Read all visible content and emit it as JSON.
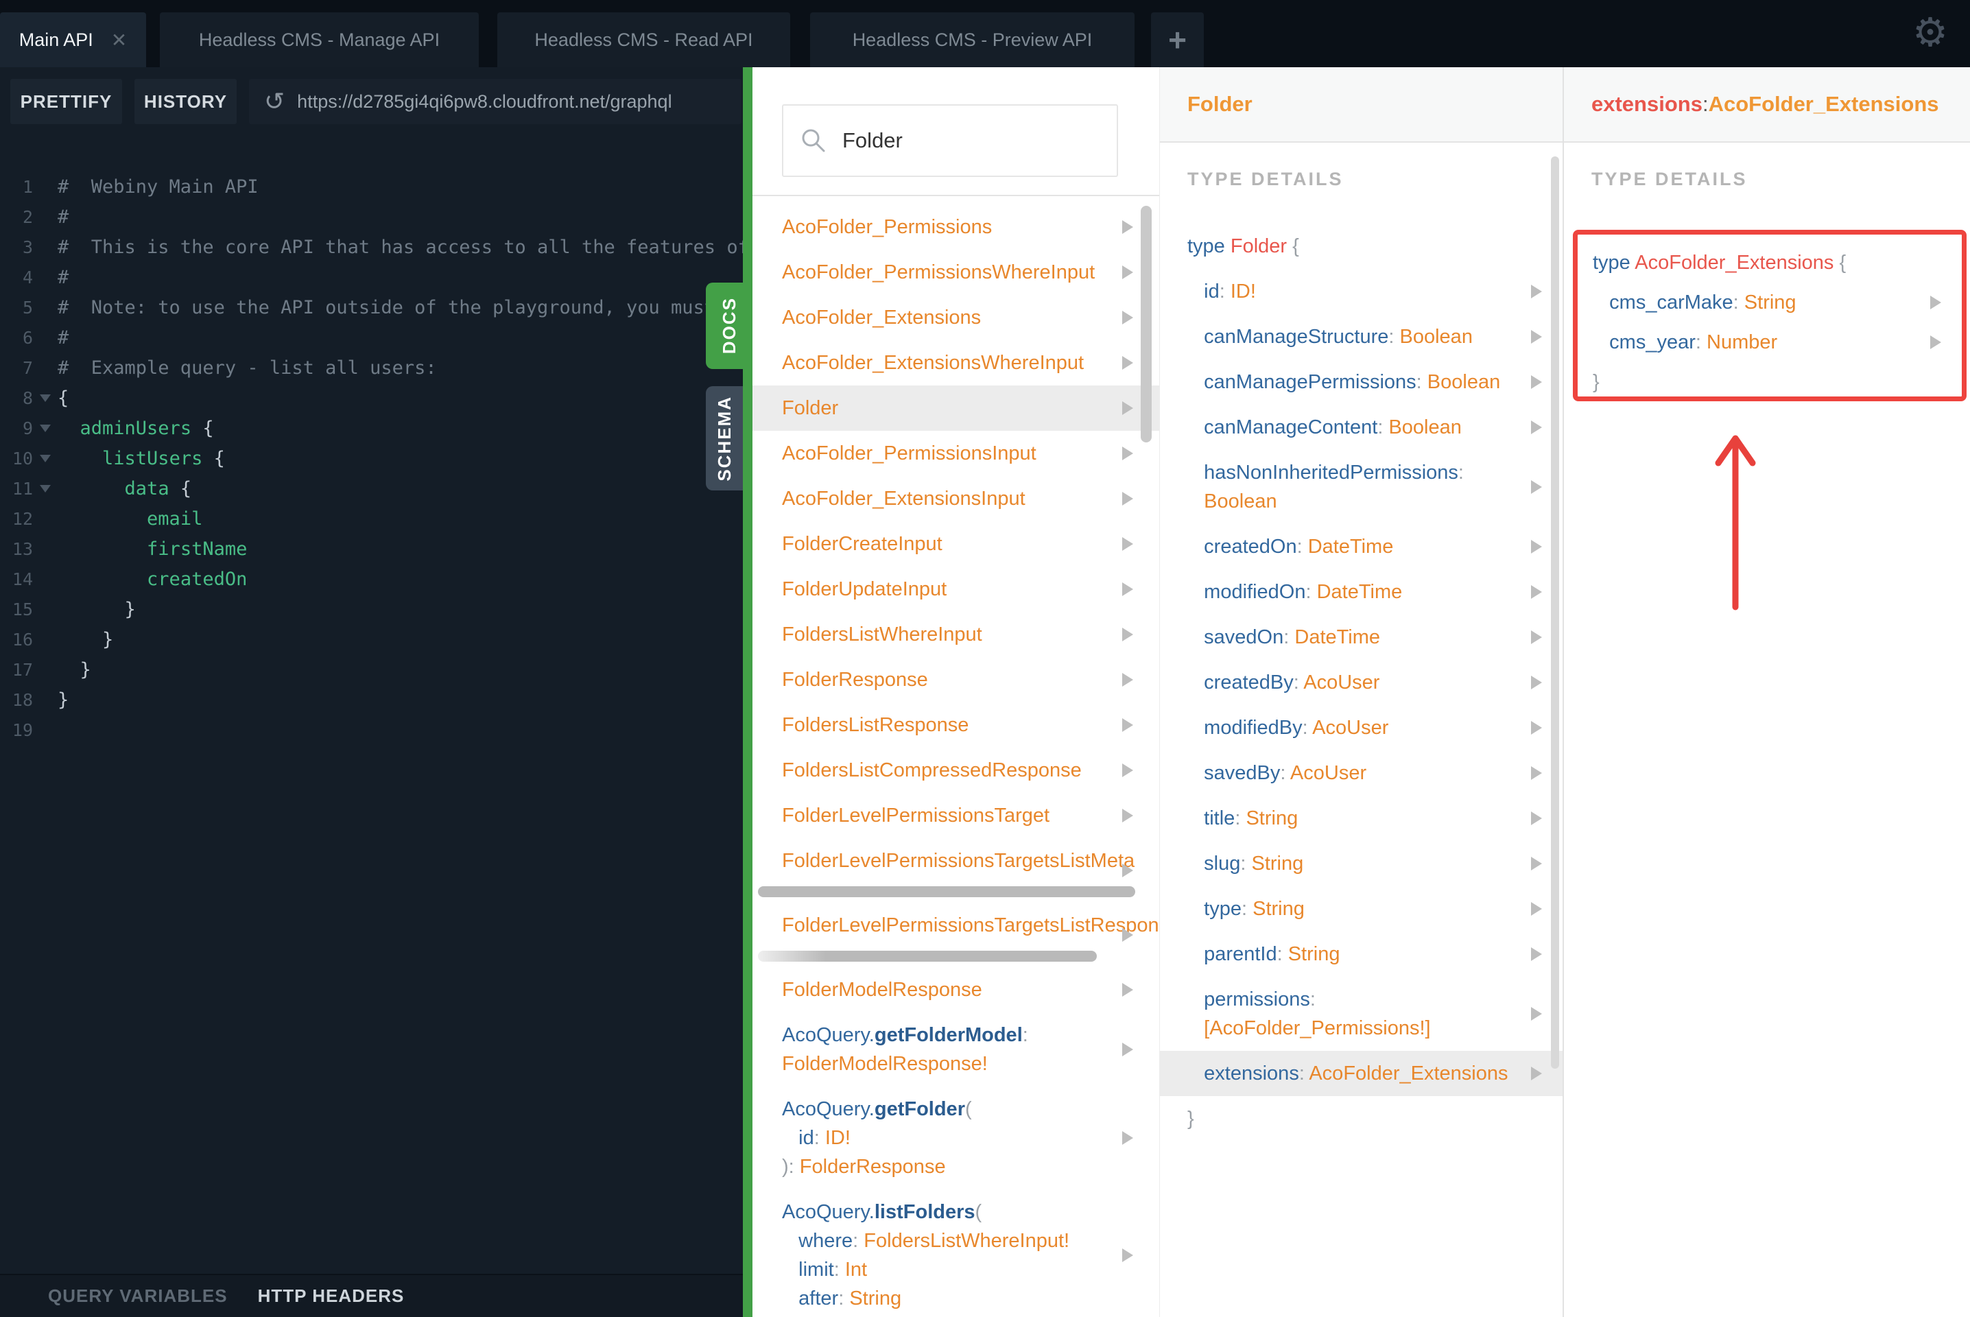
{
  "tabs": {
    "items": [
      {
        "label": "Main API",
        "active": true,
        "closable": true
      },
      {
        "label": "Headless CMS - Manage API"
      },
      {
        "label": "Headless CMS - Read API"
      },
      {
        "label": "Headless CMS - Preview API"
      }
    ],
    "add_label": "+",
    "close_label": "✕",
    "settings_icon": "⚙"
  },
  "toolbar": {
    "prettify_label": "PRETTIFY",
    "history_label": "HISTORY",
    "refresh_icon": "↺",
    "url": "https://d2785gi4qi6pw8.cloudfront.net/graphql"
  },
  "editor": {
    "lines": [
      {
        "n": 1,
        "segs": [
          [
            "#  Webiny Main API",
            "cmt"
          ]
        ]
      },
      {
        "n": 2,
        "segs": [
          [
            "#",
            "cmt"
          ]
        ]
      },
      {
        "n": 3,
        "segs": [
          [
            "#  This is the core API that has access to all the features offered by Webiny.",
            "cmt"
          ]
        ]
      },
      {
        "n": 4,
        "segs": [
          [
            "#",
            "cmt"
          ]
        ]
      },
      {
        "n": 5,
        "segs": [
          [
            "#  Note: to use the API outside of the playground, you must use the API key.",
            "cmt"
          ]
        ]
      },
      {
        "n": 6,
        "segs": [
          [
            "#",
            "cmt"
          ]
        ]
      },
      {
        "n": 7,
        "segs": [
          [
            "#  Example query - list all users:",
            "cmt"
          ]
        ]
      },
      {
        "n": 8,
        "fold": true,
        "segs": [
          [
            "{",
            "epun"
          ]
        ]
      },
      {
        "n": 9,
        "fold": true,
        "segs": [
          [
            "  ",
            ""
          ],
          [
            "adminUsers",
            "grn"
          ],
          [
            " {",
            "epun"
          ]
        ]
      },
      {
        "n": 10,
        "fold": true,
        "segs": [
          [
            "    ",
            ""
          ],
          [
            "listUsers",
            "grn"
          ],
          [
            " {",
            "epun"
          ]
        ]
      },
      {
        "n": 11,
        "fold": true,
        "segs": [
          [
            "      ",
            ""
          ],
          [
            "data",
            "grn"
          ],
          [
            " {",
            "epun"
          ]
        ]
      },
      {
        "n": 12,
        "segs": [
          [
            "        ",
            ""
          ],
          [
            "email",
            "grn"
          ]
        ]
      },
      {
        "n": 13,
        "segs": [
          [
            "        ",
            ""
          ],
          [
            "firstName",
            "grn"
          ]
        ]
      },
      {
        "n": 14,
        "segs": [
          [
            "        ",
            ""
          ],
          [
            "createdOn",
            "grn"
          ]
        ]
      },
      {
        "n": 15,
        "segs": [
          [
            "      }",
            "epun"
          ]
        ]
      },
      {
        "n": 16,
        "segs": [
          [
            "    }",
            "epun"
          ]
        ]
      },
      {
        "n": 17,
        "segs": [
          [
            "  }",
            "epun"
          ]
        ]
      },
      {
        "n": 18,
        "segs": [
          [
            "}",
            "epun"
          ]
        ]
      },
      {
        "n": 19,
        "segs": []
      }
    ]
  },
  "side_tabs": {
    "docs": "DOCS",
    "schema": "SCHEMA"
  },
  "footer": {
    "query_variables": "QUERY VARIABLES",
    "http_headers": "HTTP HEADERS"
  },
  "docs": {
    "search_value": "Folder",
    "items": [
      {
        "lines": [
          [
            [
              "AcoFolder_Permissions",
              "typ"
            ]
          ]
        ],
        "arrow": true
      },
      {
        "lines": [
          [
            [
              "AcoFolder_PermissionsWhereInput",
              "typ"
            ]
          ]
        ],
        "arrow": true
      },
      {
        "lines": [
          [
            [
              "AcoFolder_Extensions",
              "typ"
            ]
          ]
        ],
        "arrow": true
      },
      {
        "lines": [
          [
            [
              "AcoFolder_ExtensionsWhereInput",
              "typ"
            ]
          ]
        ],
        "arrow": true
      },
      {
        "lines": [
          [
            [
              "Folder",
              "typ"
            ]
          ]
        ],
        "arrow": true,
        "hl": true
      },
      {
        "lines": [
          [
            [
              "AcoFolder_PermissionsInput",
              "typ"
            ]
          ]
        ],
        "arrow": true
      },
      {
        "lines": [
          [
            [
              "AcoFolder_ExtensionsInput",
              "typ"
            ]
          ]
        ],
        "arrow": true
      },
      {
        "lines": [
          [
            [
              "FolderCreateInput",
              "typ"
            ]
          ]
        ],
        "arrow": true
      },
      {
        "lines": [
          [
            [
              "FolderUpdateInput",
              "typ"
            ]
          ]
        ],
        "arrow": true
      },
      {
        "lines": [
          [
            [
              "FoldersListWhereInput",
              "typ"
            ]
          ]
        ],
        "arrow": true
      },
      {
        "lines": [
          [
            [
              "FolderResponse",
              "typ"
            ]
          ]
        ],
        "arrow": true
      },
      {
        "lines": [
          [
            [
              "FoldersListResponse",
              "typ"
            ]
          ]
        ],
        "arrow": true
      },
      {
        "lines": [
          [
            [
              "FoldersListCompressedResponse",
              "typ"
            ]
          ]
        ],
        "arrow": true
      },
      {
        "lines": [
          [
            [
              "FolderLevelPermissionsTarget",
              "typ"
            ]
          ]
        ],
        "arrow": true
      },
      {
        "lines": [
          [
            [
              "FolderLevelPermissionsTargetsListMeta",
              "typ"
            ]
          ]
        ],
        "arrow": true,
        "hbar": 550
      },
      {
        "lines": [
          [
            [
              "FolderLevelPermissionsTargetsListResponse",
              "typ"
            ]
          ]
        ],
        "arrow": true,
        "hbar": 494,
        "fade": true
      },
      {
        "lines": [
          [
            [
              "FolderModelResponse",
              "typ"
            ]
          ]
        ],
        "arrow": true
      },
      {
        "ml": true,
        "arrow": true,
        "lines": [
          [
            [
              "AcoQuery.",
              "kw"
            ],
            [
              "getFolderModel",
              "kwb"
            ],
            [
              ":",
              "pun"
            ]
          ],
          [
            [
              "FolderModelResponse!",
              "typ"
            ]
          ]
        ]
      },
      {
        "ml": true,
        "arrow": true,
        "lines": [
          [
            [
              "AcoQuery.",
              "kw"
            ],
            [
              "getFolder",
              "kwb"
            ],
            [
              "(",
              "pun"
            ]
          ],
          [
            [
              "   ",
              ""
            ],
            [
              "id",
              "kw"
            ],
            [
              ": ",
              "pun"
            ],
            [
              "ID!",
              "typ"
            ]
          ],
          [
            [
              "): ",
              "pun"
            ],
            [
              "FolderResponse",
              "typ"
            ]
          ]
        ]
      },
      {
        "ml": true,
        "arrow": true,
        "lines": [
          [
            [
              "AcoQuery.",
              "kw"
            ],
            [
              "listFolders",
              "kwb"
            ],
            [
              "(",
              "pun"
            ]
          ],
          [
            [
              "   ",
              ""
            ],
            [
              "where",
              "kw"
            ],
            [
              ": ",
              "pun"
            ],
            [
              "FoldersListWhereInput!",
              "typ"
            ]
          ],
          [
            [
              "   ",
              ""
            ],
            [
              "limit",
              "kw"
            ],
            [
              ": ",
              "pun"
            ],
            [
              "Int",
              "typ"
            ]
          ],
          [
            [
              "   ",
              ""
            ],
            [
              "after",
              "kw"
            ],
            [
              ": ",
              "pun"
            ],
            [
              "String",
              "typ"
            ]
          ]
        ]
      }
    ]
  },
  "type_panel": {
    "title": "Folder",
    "section_label": "TYPE DETAILS",
    "lines": [
      {
        "segs": [
          [
            "type ",
            "kw"
          ],
          [
            "Folder ",
            "typname"
          ],
          [
            "{",
            "pun"
          ]
        ]
      },
      {
        "segs": [
          [
            "   ",
            ""
          ],
          [
            "id",
            "kw"
          ],
          [
            ": ",
            "pun"
          ],
          [
            "ID!",
            "typ"
          ]
        ],
        "arrow": true
      },
      {
        "segs": [
          [
            "   ",
            ""
          ],
          [
            "canManageStructure",
            "kw"
          ],
          [
            ": ",
            "pun"
          ],
          [
            "Boolean",
            "typ"
          ]
        ],
        "arrow": true
      },
      {
        "segs": [
          [
            "   ",
            ""
          ],
          [
            "canManagePermissions",
            "kw"
          ],
          [
            ": ",
            "pun"
          ],
          [
            "Boolean",
            "typ"
          ]
        ],
        "arrow": true
      },
      {
        "segs": [
          [
            "   ",
            ""
          ],
          [
            "canManageContent",
            "kw"
          ],
          [
            ": ",
            "pun"
          ],
          [
            "Boolean",
            "typ"
          ]
        ],
        "arrow": true
      },
      {
        "ml": true,
        "arrow": true,
        "lines": [
          [
            [
              "   ",
              ""
            ],
            [
              "hasNonInheritedPermissions",
              "kw"
            ],
            [
              ":",
              "pun"
            ]
          ],
          [
            [
              "   ",
              ""
            ],
            [
              "Boolean",
              "typ"
            ]
          ]
        ]
      },
      {
        "segs": [
          [
            "   ",
            ""
          ],
          [
            "createdOn",
            "kw"
          ],
          [
            ": ",
            "pun"
          ],
          [
            "DateTime",
            "typ"
          ]
        ],
        "arrow": true
      },
      {
        "segs": [
          [
            "   ",
            ""
          ],
          [
            "modifiedOn",
            "kw"
          ],
          [
            ": ",
            "pun"
          ],
          [
            "DateTime",
            "typ"
          ]
        ],
        "arrow": true
      },
      {
        "segs": [
          [
            "   ",
            ""
          ],
          [
            "savedOn",
            "kw"
          ],
          [
            ": ",
            "pun"
          ],
          [
            "DateTime",
            "typ"
          ]
        ],
        "arrow": true
      },
      {
        "segs": [
          [
            "   ",
            ""
          ],
          [
            "createdBy",
            "kw"
          ],
          [
            ": ",
            "pun"
          ],
          [
            "AcoUser",
            "typ"
          ]
        ],
        "arrow": true
      },
      {
        "segs": [
          [
            "   ",
            ""
          ],
          [
            "modifiedBy",
            "kw"
          ],
          [
            ": ",
            "pun"
          ],
          [
            "AcoUser",
            "typ"
          ]
        ],
        "arrow": true
      },
      {
        "segs": [
          [
            "   ",
            ""
          ],
          [
            "savedBy",
            "kw"
          ],
          [
            ": ",
            "pun"
          ],
          [
            "AcoUser",
            "typ"
          ]
        ],
        "arrow": true
      },
      {
        "segs": [
          [
            "   ",
            ""
          ],
          [
            "title",
            "kw"
          ],
          [
            ": ",
            "pun"
          ],
          [
            "String",
            "typ"
          ]
        ],
        "arrow": true
      },
      {
        "segs": [
          [
            "   ",
            ""
          ],
          [
            "slug",
            "kw"
          ],
          [
            ": ",
            "pun"
          ],
          [
            "String",
            "typ"
          ]
        ],
        "arrow": true
      },
      {
        "segs": [
          [
            "   ",
            ""
          ],
          [
            "type",
            "kw"
          ],
          [
            ": ",
            "pun"
          ],
          [
            "String",
            "typ"
          ]
        ],
        "arrow": true
      },
      {
        "segs": [
          [
            "   ",
            ""
          ],
          [
            "parentId",
            "kw"
          ],
          [
            ": ",
            "pun"
          ],
          [
            "String",
            "typ"
          ]
        ],
        "arrow": true
      },
      {
        "ml": true,
        "arrow": true,
        "lines": [
          [
            [
              "   ",
              ""
            ],
            [
              "permissions",
              "kw"
            ],
            [
              ":",
              "pun"
            ]
          ],
          [
            [
              "   ",
              ""
            ],
            [
              "[AcoFolder_Permissions!]",
              "typ"
            ]
          ]
        ]
      },
      {
        "segs": [
          [
            "   ",
            ""
          ],
          [
            "extensions",
            "kw"
          ],
          [
            ": ",
            "pun"
          ],
          [
            "AcoFolder_Extensions",
            "typ"
          ]
        ],
        "arrow": true,
        "hl": true
      },
      {
        "segs": [
          [
            "}",
            "pun"
          ]
        ]
      }
    ]
  },
  "extensions_panel": {
    "title_field": "extensions",
    "title_colon": ": ",
    "title_type": "AcoFolder_Extensions",
    "section_label": "TYPE DETAILS",
    "lines": [
      {
        "segs": [
          [
            "type ",
            "kw"
          ],
          [
            "AcoFolder_Extensions ",
            "typname"
          ],
          [
            "{",
            "pun"
          ]
        ]
      },
      {
        "segs": [
          [
            "   ",
            ""
          ],
          [
            "cms_carMake",
            "kw"
          ],
          [
            ": ",
            "pun"
          ],
          [
            "String",
            "typ"
          ]
        ],
        "arrow": true
      },
      {
        "segs": [
          [
            "   ",
            ""
          ],
          [
            "cms_year",
            "kw"
          ],
          [
            ": ",
            "pun"
          ],
          [
            "Number",
            "typ"
          ]
        ],
        "arrow": true
      },
      {
        "segs": [
          [
            "}",
            "pun"
          ]
        ]
      }
    ]
  },
  "colors": {
    "divider_green": "#43a047",
    "type_orange": "#e8872c",
    "field_blue": "#33689e",
    "typename_coral": "#e8564c",
    "annotation_red": "#ee443e",
    "editor_green": "#49bd87"
  }
}
